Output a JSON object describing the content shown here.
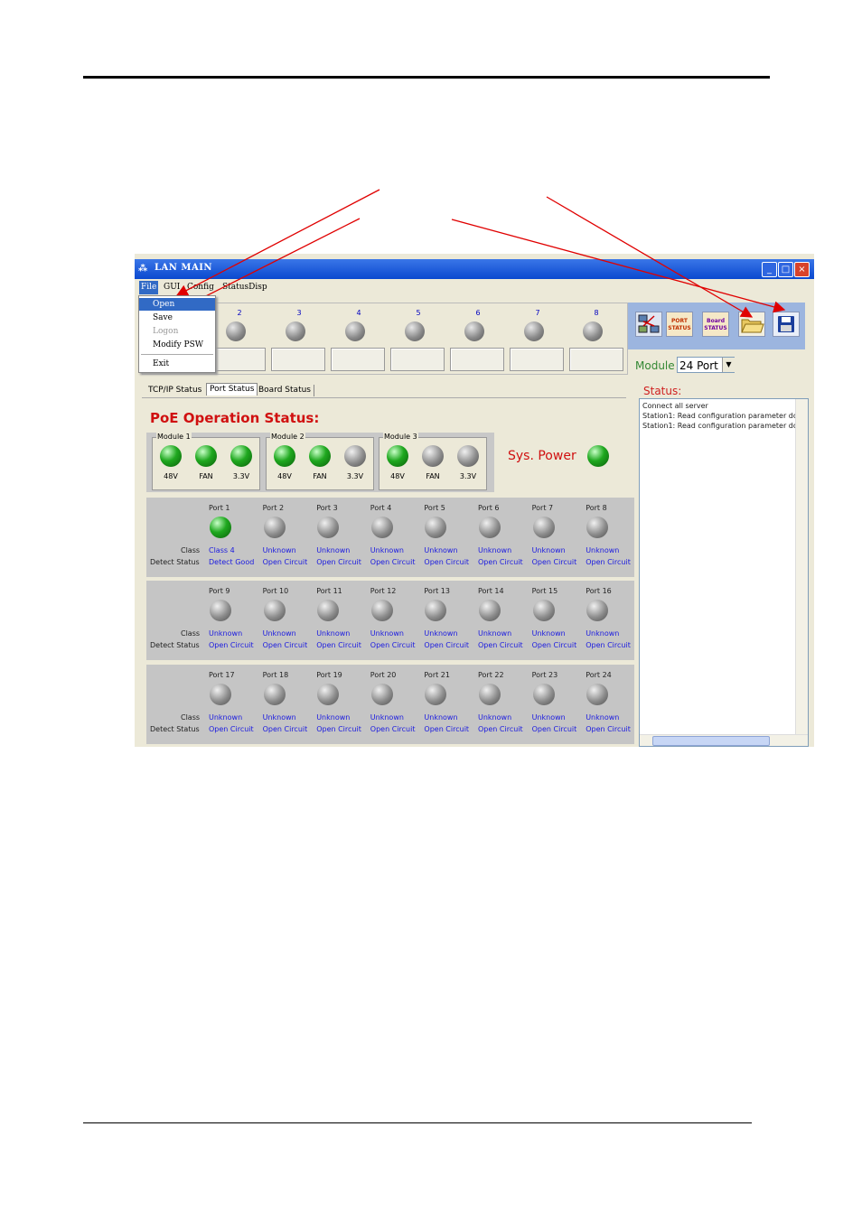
{
  "window": {
    "title": "LAN MAIN",
    "buttons": {
      "minimize": "_",
      "maximize": "□",
      "close": "×"
    }
  },
  "menubar": {
    "items": [
      "File",
      "GUI",
      "Config",
      "StatusDisp"
    ]
  },
  "file_menu": {
    "items": [
      {
        "label": "Open",
        "state": "highlighted"
      },
      {
        "label": "Save",
        "state": "normal"
      },
      {
        "label": "Logon",
        "state": "disabled"
      },
      {
        "label": "Modify PSW",
        "state": "normal"
      },
      {
        "label": "Exit",
        "state": "normal"
      }
    ]
  },
  "top_columns": [
    "2",
    "3",
    "4",
    "5",
    "6",
    "7",
    "8"
  ],
  "toolbar": {
    "buttons": [
      {
        "name": "network-config",
        "icon": "network-icon"
      },
      {
        "name": "port-status",
        "label": "PORT STATUS"
      },
      {
        "name": "board-status",
        "label": "Board STATUS"
      },
      {
        "name": "open-folder",
        "icon": "folder-open-icon"
      },
      {
        "name": "save-disk",
        "icon": "floppy-disk-icon"
      }
    ]
  },
  "module_selector": {
    "label": "Module",
    "value": "24 Port"
  },
  "tabs": [
    {
      "label": "TCP/IP Status",
      "active": false
    },
    {
      "label": "Port Status",
      "active": true
    },
    {
      "label": "Board Status",
      "active": false
    }
  ],
  "status_panel": {
    "label": "Status:",
    "lines": [
      "Connect all server",
      "Station1: Read configuration parameter do",
      "Station1: Read configuration parameter do"
    ]
  },
  "poe": {
    "title": "PoE Operation Status:",
    "modules": [
      {
        "title": "Module 1",
        "leds": [
          {
            "label": "48V",
            "state": "green"
          },
          {
            "label": "FAN",
            "state": "green"
          },
          {
            "label": "3.3V",
            "state": "green"
          }
        ]
      },
      {
        "title": "Module 2",
        "leds": [
          {
            "label": "48V",
            "state": "green"
          },
          {
            "label": "FAN",
            "state": "green"
          },
          {
            "label": "3.3V",
            "state": "gray"
          }
        ]
      },
      {
        "title": "Module 3",
        "leds": [
          {
            "label": "48V",
            "state": "green"
          },
          {
            "label": "FAN",
            "state": "gray"
          },
          {
            "label": "3.3V",
            "state": "gray"
          }
        ]
      }
    ],
    "sys_power": {
      "label": "Sys. Power",
      "state": "green"
    },
    "row_labels": {
      "class": "Class",
      "detect": "Detect Status"
    },
    "port_groups": [
      [
        {
          "name": "Port 1",
          "led": "green",
          "class": "Class 4",
          "detect": "Detect Good"
        },
        {
          "name": "Port 2",
          "led": "gray",
          "class": "Unknown",
          "detect": "Open Circuit"
        },
        {
          "name": "Port 3",
          "led": "gray",
          "class": "Unknown",
          "detect": "Open Circuit"
        },
        {
          "name": "Port 4",
          "led": "gray",
          "class": "Unknown",
          "detect": "Open Circuit"
        },
        {
          "name": "Port 5",
          "led": "gray",
          "class": "Unknown",
          "detect": "Open Circuit"
        },
        {
          "name": "Port 6",
          "led": "gray",
          "class": "Unknown",
          "detect": "Open Circuit"
        },
        {
          "name": "Port 7",
          "led": "gray",
          "class": "Unknown",
          "detect": "Open Circuit"
        },
        {
          "name": "Port 8",
          "led": "gray",
          "class": "Unknown",
          "detect": "Open Circuit"
        }
      ],
      [
        {
          "name": "Port 9",
          "led": "gray",
          "class": "Unknown",
          "detect": "Open Circuit"
        },
        {
          "name": "Port 10",
          "led": "gray",
          "class": "Unknown",
          "detect": "Open Circuit"
        },
        {
          "name": "Port 11",
          "led": "gray",
          "class": "Unknown",
          "detect": "Open Circuit"
        },
        {
          "name": "Port 12",
          "led": "gray",
          "class": "Unknown",
          "detect": "Open Circuit"
        },
        {
          "name": "Port 13",
          "led": "gray",
          "class": "Unknown",
          "detect": "Open Circuit"
        },
        {
          "name": "Port 14",
          "led": "gray",
          "class": "Unknown",
          "detect": "Open Circuit"
        },
        {
          "name": "Port 15",
          "led": "gray",
          "class": "Unknown",
          "detect": "Open Circuit"
        },
        {
          "name": "Port 16",
          "led": "gray",
          "class": "Unknown",
          "detect": "Open Circuit"
        }
      ],
      [
        {
          "name": "Port 17",
          "led": "gray",
          "class": "Unknown",
          "detect": "Open Circuit"
        },
        {
          "name": "Port 18",
          "led": "gray",
          "class": "Unknown",
          "detect": "Open Circuit"
        },
        {
          "name": "Port 19",
          "led": "gray",
          "class": "Unknown",
          "detect": "Open Circuit"
        },
        {
          "name": "Port 20",
          "led": "gray",
          "class": "Unknown",
          "detect": "Open Circuit"
        },
        {
          "name": "Port 21",
          "led": "gray",
          "class": "Unknown",
          "detect": "Open Circuit"
        },
        {
          "name": "Port 22",
          "led": "gray",
          "class": "Unknown",
          "detect": "Open Circuit"
        },
        {
          "name": "Port 23",
          "led": "gray",
          "class": "Unknown",
          "detect": "Open Circuit"
        },
        {
          "name": "Port 24",
          "led": "gray",
          "class": "Unknown",
          "detect": "Open Circuit"
        }
      ]
    ]
  },
  "colors": {
    "accent": "#316ac5",
    "led_green": "#1fa81f",
    "title_red": "#d01010",
    "link_blue": "#1a1ae0",
    "arrow": "#e00000"
  }
}
